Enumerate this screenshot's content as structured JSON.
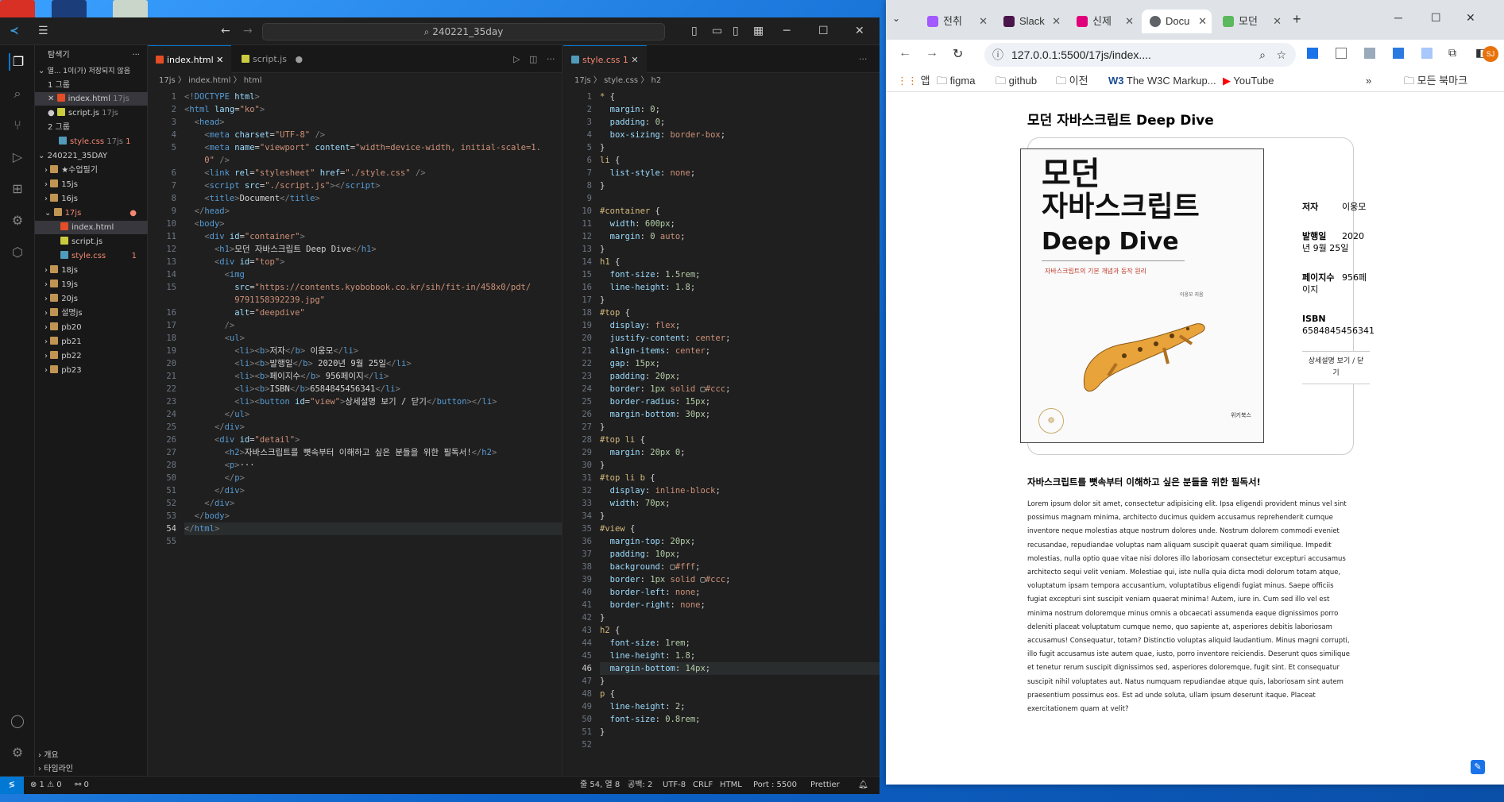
{
  "vscode": {
    "search_text": "240221_35day",
    "sidebar": {
      "title": "탐색기",
      "open_editors_label": "열... 1이(가) 저장되지 않음",
      "group1_label": "1 그룹",
      "group2_label": "2 그룹",
      "open_files": [
        {
          "name": "index.html",
          "dir": "17js"
        },
        {
          "name": "script.js",
          "dir": "17js"
        },
        {
          "name": "style.css",
          "dir": "17js",
          "badge": "1"
        }
      ],
      "workspace": "240221_35DAY",
      "tree": [
        "★수업필기",
        "15js",
        "16js",
        "17js",
        "index.html",
        "script.js",
        "style.css",
        "18js",
        "19js",
        "20js",
        "설명js",
        "pb20",
        "pb21",
        "pb22",
        "pb23"
      ],
      "style_badge": "1",
      "outline_label": "개요",
      "timeline_label": "타임라인"
    },
    "left_tabs": [
      {
        "label": "index.html"
      },
      {
        "label": "script.js"
      }
    ],
    "right_tabs": [
      {
        "label": "style.css",
        "badge": "1"
      }
    ],
    "left_crumbs": "17js 〉 index.html 〉 html",
    "right_crumbs": "17js 〉 style.css 〉 h2",
    "status": {
      "errors": "⊗ 1 ⚠ 0",
      "ports": "⚯ 0",
      "position": "줄 54, 열 8",
      "spaces": "공백: 2",
      "encoding": "UTF-8",
      "eol": "CRLF",
      "lang": "HTML",
      "port": "Port : 5500",
      "prettier": "Prettier"
    }
  },
  "chrome": {
    "tabs": [
      {
        "label": "전취"
      },
      {
        "label": "Slack"
      },
      {
        "label": "신제"
      },
      {
        "label": "Docu"
      },
      {
        "label": "모던"
      }
    ],
    "url": "127.0.0.1:5500/17js/index....",
    "profile_initials": "SJ",
    "bookmarks": [
      "앱",
      "figma",
      "github",
      "이전",
      "The W3C Markup...",
      "YouTube"
    ],
    "bookmarks_all": "모든 북마크",
    "page": {
      "h1": "모던 자바스크립트 Deep Dive",
      "cover": {
        "title_line1": "모던",
        "title_line2": "자바스크립트",
        "title_line3": "Deep Dive",
        "subtitle": "자바스크립트의 기본 개념과 동작 원리",
        "author_line": "이웅모 지음",
        "publisher": "위키북스"
      },
      "info": [
        {
          "label": "저자",
          "value": "이웅모"
        },
        {
          "label": "발행일",
          "value": "2020년 9월 25일"
        },
        {
          "label": "페이지수",
          "value": "956페이지"
        },
        {
          "label": "ISBN",
          "value": "6584845456341"
        }
      ],
      "button": "상세설명 보기 / 닫기",
      "detail_title": "자바스크립트를 뼛속부터 이해하고 싶은 분들을 위한 필독서!",
      "detail_text": "Lorem ipsum dolor sit amet, consectetur adipisicing elit. Ipsa eligendi provident minus vel sint possimus magnam minima, architecto ducimus quidem accusamus reprehenderit cumque inventore neque molestias atque nostrum dolores unde. Nostrum dolorem commodi eveniet recusandae, repudiandae voluptas nam aliquam suscipit quaerat quam similique. Impedit molestias, nulla optio quae vitae nisi dolores illo laboriosam consectetur excepturi accusamus architecto sequi velit veniam. Molestiae qui, iste nulla quia dicta modi dolorum totam atque, voluptatum ipsam tempora accusantium, voluptatibus eligendi fugiat minus. Saepe officiis fugiat excepturi sint suscipit veniam quaerat minima! Autem, iure in. Cum sed illo vel est minima nostrum doloremque minus omnis a obcaecati assumenda eaque dignissimos porro deleniti placeat voluptatum cumque nemo, quo sapiente at, asperiores debitis laboriosam accusamus! Consequatur, totam? Distinctio voluptas aliquid laudantium. Minus magni corrupti, illo fugit accusamus iste autem quae, iusto, porro inventore reiciendis. Deserunt quos similique et tenetur rerum suscipit dignissimos sed, asperiores doloremque, fugit sint. Et consequatur suscipit nihil voluptates aut. Natus numquam repudiandae atque quis, laboriosam sint autem praesentium possimus eos. Est ad unde soluta, ullam ipsum deserunt itaque. Placeat exercitationem quam at velit?"
    }
  }
}
